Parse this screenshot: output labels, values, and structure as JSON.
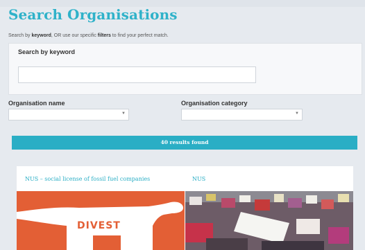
{
  "page": {
    "title": "Search Organisations",
    "subtitle_pre": "Search by ",
    "subtitle_kw": "keyword",
    "subtitle_mid": ", OR use our specific ",
    "subtitle_filters": "filters",
    "subtitle_post": " to find your perfect match."
  },
  "keyword_search": {
    "label": "Search by keyword",
    "value": "",
    "placeholder": ""
  },
  "filters": {
    "org_name_label": "Organisation name",
    "org_name_value": "",
    "org_category_label": "Organisation category",
    "org_category_value": ""
  },
  "results": {
    "count_text": "40 results found"
  },
  "cards": [
    {
      "title": "NUS – social license of fossil fuel companies",
      "image_text": "DIVEST"
    },
    {
      "title": "NUS",
      "image_text": ""
    }
  ],
  "colors": {
    "accent": "#2fb2c9",
    "divest_orange": "#e35f35"
  }
}
